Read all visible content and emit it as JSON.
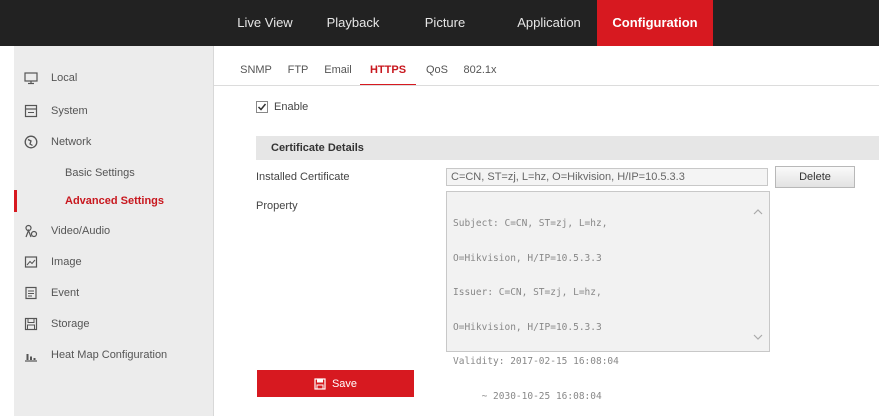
{
  "topnav": {
    "items": [
      {
        "label": "Live View"
      },
      {
        "label": "Playback"
      },
      {
        "label": "Picture"
      },
      {
        "label": "Application"
      },
      {
        "label": "Configuration"
      }
    ]
  },
  "sidebar": {
    "items": [
      {
        "label": "Local",
        "icon": "monitor-icon"
      },
      {
        "label": "System",
        "icon": "system-icon"
      },
      {
        "label": "Network",
        "icon": "globe-icon"
      },
      {
        "label": "Basic Settings"
      },
      {
        "label": "Advanced Settings"
      },
      {
        "label": "Video/Audio",
        "icon": "video-audio-icon"
      },
      {
        "label": "Image",
        "icon": "image-icon"
      },
      {
        "label": "Event",
        "icon": "event-icon"
      },
      {
        "label": "Storage",
        "icon": "storage-icon"
      },
      {
        "label": "Heat Map Configuration",
        "icon": "heatmap-icon"
      }
    ]
  },
  "tabs": [
    {
      "label": "SNMP"
    },
    {
      "label": "FTP"
    },
    {
      "label": "Email"
    },
    {
      "label": "HTTPS"
    },
    {
      "label": "QoS"
    },
    {
      "label": "802.1x"
    }
  ],
  "https": {
    "enable_label": "Enable",
    "enable_checked": true,
    "section_title": "Certificate Details",
    "installed_label": "Installed Certificate",
    "installed_value": "C=CN, ST=zj, L=hz, O=Hikvision, H/IP=10.5.3.3",
    "delete_label": "Delete",
    "property_label": "Property",
    "property_lines": [
      "Subject: C=CN, ST=zj, L=hz,",
      "O=Hikvision, H/IP=10.5.3.3",
      "Issuer: C=CN, ST=zj, L=hz,",
      "O=Hikvision, H/IP=10.5.3.3",
      "Validity: 2017-02-15 16:08:04",
      "     ~ 2030-10-25 16:08:04"
    ],
    "save_label": "Save"
  },
  "colors": {
    "accent": "#d71920",
    "topbar": "#222222",
    "sidebar_bg": "#ececec"
  }
}
